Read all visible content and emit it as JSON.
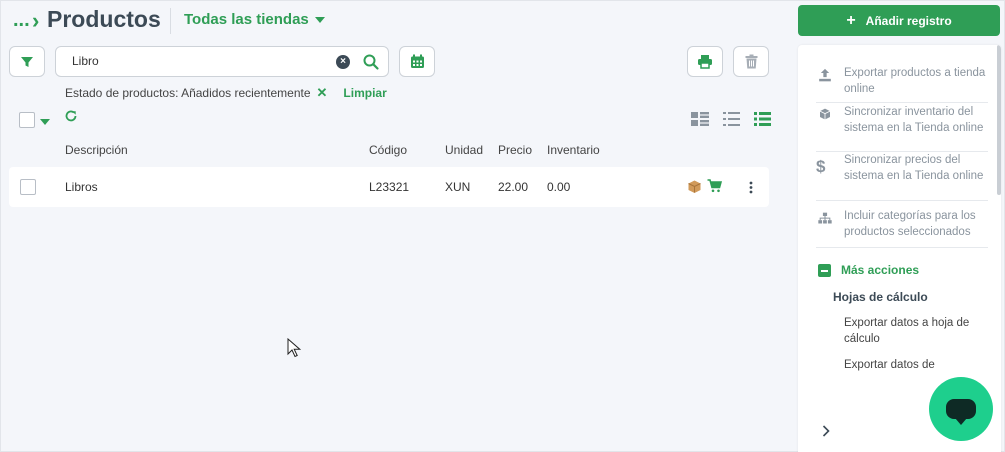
{
  "header": {
    "breadcrumb_dots": "...",
    "title": "Productos",
    "store_selector": "Todas las tiendas",
    "add_button": "Añadir registro"
  },
  "search": {
    "value": "Libro",
    "placeholder": ""
  },
  "filters": {
    "active_filter": "Estado de productos: Añadidos recientemente",
    "clear_label": "Limpiar"
  },
  "table": {
    "columns": [
      "Descripción",
      "Código",
      "Unidad",
      "Precio",
      "Inventario"
    ],
    "rows": [
      {
        "description": "Libros",
        "code": "L23321",
        "unit": "XUN",
        "price": "22.00",
        "inventory": "0.00"
      }
    ]
  },
  "side_panel": {
    "items": [
      "Exportar productos a tienda online",
      "Sincronizar inventario del sistema en la Tienda online",
      "Sincronizar precios del sistema en la Tienda online",
      "Incluir categorías para los productos seleccionados"
    ],
    "more_actions": "Más acciones",
    "spreadsheets_heading": "Hojas de cálculo",
    "spreadsheet_items": [
      "Exportar datos a hoja de cálculo",
      "Exportar datos de"
    ]
  },
  "colors": {
    "accent": "#2f9e56",
    "title": "#3c4a56",
    "chat": "#1ecf8d"
  },
  "icons": [
    "filter-icon",
    "search-icon",
    "calendar-icon",
    "printer-icon",
    "trash-icon",
    "refresh-icon",
    "box-icon",
    "cart-icon",
    "kebab-icon",
    "upload-icon",
    "dollar-icon",
    "hierarchy-icon",
    "chat-icon"
  ]
}
